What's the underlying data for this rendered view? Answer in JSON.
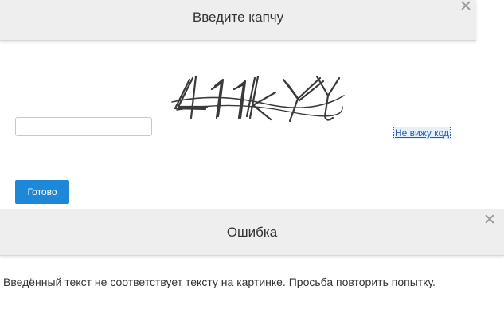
{
  "captcha_dialog": {
    "title": "Введите капчу",
    "input_value": "",
    "input_placeholder": "",
    "captcha_text": "41kY",
    "cant_see_link": "Не вижу код",
    "submit_label": "Готово",
    "close_icon": "close-icon"
  },
  "error_dialog": {
    "title": "Ошибка",
    "message": "Введённый текст не соответствует тексту на картинке. Просьба повторить попытку.",
    "close_icon": "close-icon"
  },
  "colors": {
    "header_bg": "#eeeeee",
    "button_bg": "#1e88d8",
    "link": "#2a5db0"
  }
}
